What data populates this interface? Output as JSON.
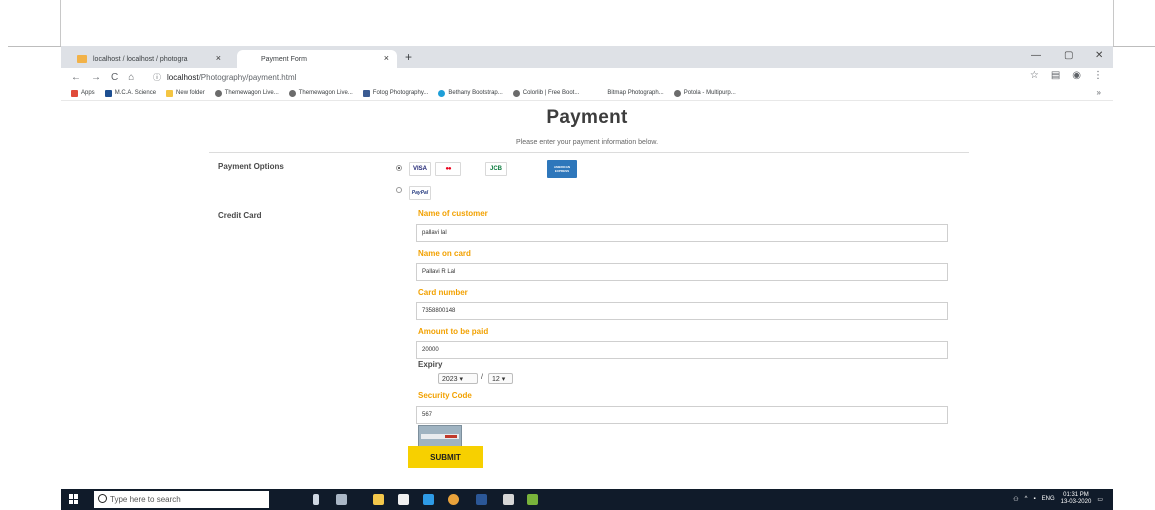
{
  "browser": {
    "tabs": [
      {
        "label": "localhost / localhost / photogra"
      },
      {
        "label": "Payment Form"
      }
    ],
    "new_tab": "+",
    "tab_close": "×",
    "window_controls": [
      "—",
      "▢",
      "✕"
    ],
    "nav": {
      "back": "←",
      "forward": "→",
      "reload": "C",
      "home": "⌂"
    },
    "address": {
      "info": "ⓘ",
      "host": "localhost",
      "path": "/Photography/payment.html"
    },
    "toolbar_right": [
      "☆",
      "▤",
      "◉",
      "⋮"
    ],
    "bookmarks": [
      {
        "label": "Apps"
      },
      {
        "label": "M.C.A. Science"
      },
      {
        "label": "New folder"
      },
      {
        "label": "Themewagon Live..."
      },
      {
        "label": "Themewagon Live..."
      },
      {
        "label": "Fotog Photography..."
      },
      {
        "label": "Bethany Bootstrap..."
      },
      {
        "label": "Colorlib | Free Boot..."
      },
      {
        "label": "Bitmap Photograph..."
      },
      {
        "label": "Potola - Multipurp..."
      }
    ],
    "bookmarks_more": "»"
  },
  "page": {
    "title": "Payment",
    "subtitle": "Please enter your payment information below.",
    "payment_options_label": "Payment Options",
    "cards": {
      "visa": "VISA",
      "mastercard": "●●",
      "jcb": "JCB",
      "amex": "AMERICAN EXPRESS",
      "paypal": "PayPal"
    },
    "credit_card_label": "Credit Card",
    "fields": {
      "customer_name": {
        "label": "Name of customer",
        "value": "pallavi lal"
      },
      "card_name": {
        "label": "Name on card",
        "value": "Pallavi R Lal"
      },
      "card_number": {
        "label": "Card number",
        "value": "7358800148"
      },
      "amount": {
        "label": "Amount to be paid",
        "value": "20000"
      },
      "security_code": {
        "label": "Security Code",
        "value": "567"
      }
    },
    "expiry": {
      "label": "Expiry",
      "year": "2023 ▾",
      "month": "12 ▾",
      "separator": "/"
    },
    "submit_label": "SUBMIT"
  },
  "taskbar": {
    "search_placeholder": "Type here to search",
    "tray": {
      "lang": "ENG",
      "time": "01:31 PM",
      "date": "13-03-2020"
    }
  },
  "colors": {
    "accent_orange": "#f2a100",
    "submit_yellow": "#f7d000",
    "taskbar": "#101b2a"
  }
}
